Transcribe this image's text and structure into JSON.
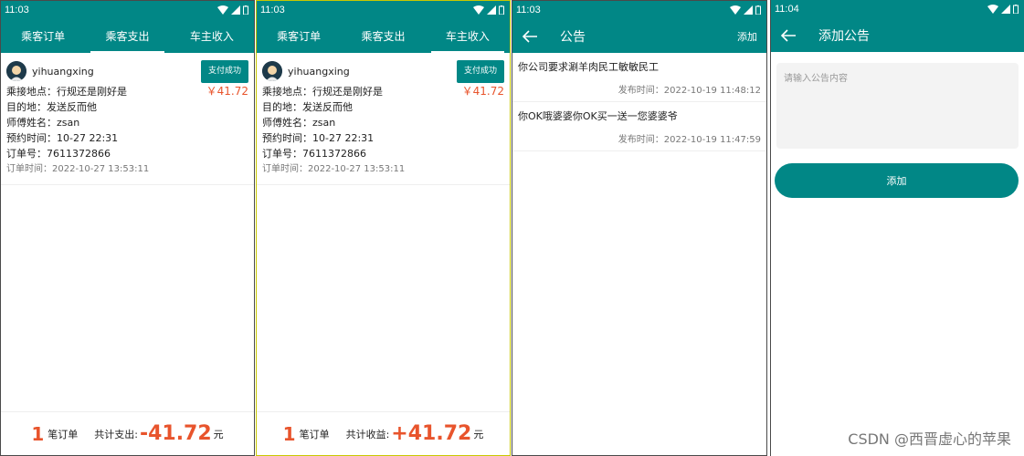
{
  "screens": {
    "p1": {
      "time": "11:03",
      "tabs": [
        "乘客订单",
        "乘客支出",
        "车主收入"
      ],
      "active_tab": 1,
      "order": {
        "username": "yihuangxing",
        "pay_status": "支付成功",
        "price": "￥41.72",
        "pickup": "乘接地点：行规还是刚好是",
        "destination": "目的地：发送反而他",
        "driver": "师傅姓名：zsan",
        "appointment": "预约时间：10-27 22:31",
        "order_no": "订单号：7611372866",
        "order_time": "订单时间：2022-10-27 13:53:11"
      },
      "footer": {
        "count": "1",
        "count_unit": "笔订单",
        "total_label": "共计支出:",
        "total": "-41.72",
        "unit": "元"
      }
    },
    "p2": {
      "time": "11:03",
      "tabs": [
        "乘客订单",
        "乘客支出",
        "车主收入"
      ],
      "active_tab": 2,
      "order": {
        "username": "yihuangxing",
        "pay_status": "支付成功",
        "price": "￥41.72",
        "pickup": "乘接地点：行规还是刚好是",
        "destination": "目的地：发送反而他",
        "driver": "师傅姓名：zsan",
        "appointment": "预约时间：10-27 22:31",
        "order_no": "订单号：7611372866",
        "order_time": "订单时间：2022-10-27 13:53:11"
      },
      "footer": {
        "count": "1",
        "count_unit": "笔订单",
        "total_label": "共计收益:",
        "total": "+41.72",
        "unit": "元"
      }
    },
    "p3": {
      "time": "11:03",
      "title": "公告",
      "action": "添加",
      "notices": [
        {
          "text": "你公司要求涮羊肉民工敏敏民工",
          "time": "发布时间：2022-10-19 11:48:12"
        },
        {
          "text": "你OK哦婆婆你OK买一送一您婆婆爷",
          "time": "发布时间：2022-10-19 11:47:59"
        }
      ]
    },
    "p4": {
      "time": "11:04",
      "title": "添加公告",
      "placeholder": "请输入公告内容",
      "button": "添加"
    }
  },
  "watermark": "CSDN @西晋虚心的苹果",
  "colors": {
    "primary": "#018786",
    "price": "#e8542c"
  }
}
